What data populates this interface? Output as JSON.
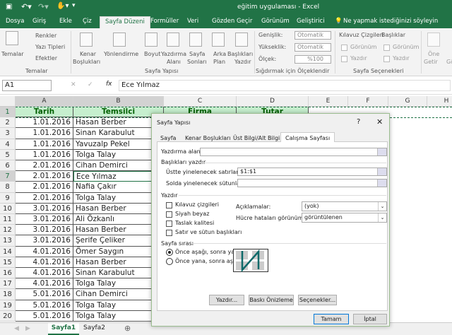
{
  "window": {
    "title": "eğitim uygulaması  -  Excel"
  },
  "ribbon_tabs": [
    "Dosya",
    "Giriş",
    "Ekle",
    "Çiz",
    "Sayfa Düzeni",
    "Formüller",
    "Veri",
    "Gözden Geçir",
    "Görünüm",
    "Geliştirici"
  ],
  "tell_me": "Ne yapmak istediğinizi söyleyin",
  "ribbon": {
    "themes": {
      "temalar": "Temalar",
      "renkler": "Renkler",
      "yazi_tipleri": "Yazı Tipleri",
      "efektler": "Efektler",
      "group": "Temalar"
    },
    "page_setup": {
      "kenar": "Kenar",
      "bosluklari": "Boşlukları",
      "yonlendirme": "Yönlendirme",
      "boyut": "Boyut",
      "yazdirma": "Yazdırma",
      "alani": "Alanı",
      "sayfa": "Sayfa",
      "sonlari": "Sonları",
      "arka": "Arka",
      "plan": "Plan",
      "basliklari": "Başlıkları",
      "yazdir": "Yazdır",
      "group": "Sayfa Yapısı"
    },
    "scale": {
      "genislik": "Genişlik:",
      "genislik_val": "Otomatik",
      "yukseklik": "Yükseklik:",
      "yukseklik_val": "Otomatik",
      "olcek": "Ölçek:",
      "olcek_val": "%100",
      "group": "Sığdırmak için Ölçeklendir"
    },
    "sheet_options": {
      "kilavuz": "Kılavuz Çizgileri",
      "basliklar": "Başlıklar",
      "gorunum": "Görünüm",
      "yazdir": "Yazdır",
      "group": "Sayfa Seçenekleri"
    },
    "arrange": {
      "one": "Öne",
      "getir": "Getir",
      "a": "A",
      "go": "Gö"
    }
  },
  "formula_bar": {
    "name_box": "A1",
    "fx": "fx",
    "value": "Ece Yılmaz"
  },
  "columns": [
    "A",
    "B",
    "C",
    "D",
    "E",
    "F",
    "G",
    "H"
  ],
  "headers": [
    "Tarih",
    "Temsilci",
    "Firma",
    "Tutar"
  ],
  "rows": [
    [
      "1.01.2016",
      "Hasan Berber"
    ],
    [
      "1.01.2016",
      "Sinan Karabulut"
    ],
    [
      "1.01.2016",
      "Yavuzalp Pekel"
    ],
    [
      "1.01.2016",
      "Tolga Talay"
    ],
    [
      "2.01.2016",
      "Cihan Demirci"
    ],
    [
      "2.01.2016",
      "Ece Yılmaz"
    ],
    [
      "2.01.2016",
      "Nafia Çakır"
    ],
    [
      "2.01.2016",
      "Tolga Talay"
    ],
    [
      "3.01.2016",
      "Hasan Berber"
    ],
    [
      "3.01.2016",
      "Ali Özkanlı"
    ],
    [
      "3.01.2016",
      "Hasan Berber"
    ],
    [
      "3.01.2016",
      "Şerife Çeliker"
    ],
    [
      "4.01.2016",
      "Ömer Saygın"
    ],
    [
      "4.01.2016",
      "Hasan Berber"
    ],
    [
      "4.01.2016",
      "Sinan Karabulut"
    ],
    [
      "4.01.2016",
      "Tolga Talay"
    ],
    [
      "5.01.2016",
      "Cihan Demirci"
    ],
    [
      "5.01.2016",
      "Tolga Talay"
    ],
    [
      "5.01.2016",
      "Tolga Talay"
    ]
  ],
  "sheet_tabs": [
    "Sayfa1",
    "Sayfa2"
  ],
  "dialog": {
    "title": "Sayfa Yapısı",
    "help": "?",
    "close": "✕",
    "tabs": [
      "Sayfa",
      "Kenar Boşlukları",
      "Üst Bilgi/Alt Bilgi",
      "Calışma Sayfası"
    ],
    "print_area_label": "Yazdırma alanı:",
    "print_area_value": "",
    "print_titles": "Başlıkları yazdır",
    "rows_repeat_label": "Üstte yinelenecek satırlar:",
    "rows_repeat_value": "$1:$1",
    "cols_repeat_label": "Solda yinelenecek sütunlar:",
    "cols_repeat_value": "",
    "print_section": "Yazdır",
    "checks": [
      {
        "label": "Kılavuz çizgileri",
        "checked": false
      },
      {
        "label": "Siyah beyaz",
        "checked": false
      },
      {
        "label": "Taslak kalitesi",
        "checked": false
      },
      {
        "label": "Satır ve sütun başlıkları",
        "checked": false
      }
    ],
    "comments_label": "Açıklamalar:",
    "comments_value": "(yok)",
    "errors_label": "Hücre hataları görünümü:",
    "errors_value": "görüntülenen",
    "order_section": "Sayfa sırası",
    "order": [
      {
        "label": "Önce aşağı, sonra yana",
        "selected": true
      },
      {
        "label": "Önce yana, sonra aşağı",
        "selected": false
      }
    ],
    "buttons": {
      "print": "Yazdır...",
      "preview": "Baskı Önizleme",
      "options": "Seçenekler...",
      "ok": "Tamam",
      "cancel": "İptal"
    }
  },
  "colors": {
    "excel_green": "#217346",
    "selection": "#c6efce"
  }
}
